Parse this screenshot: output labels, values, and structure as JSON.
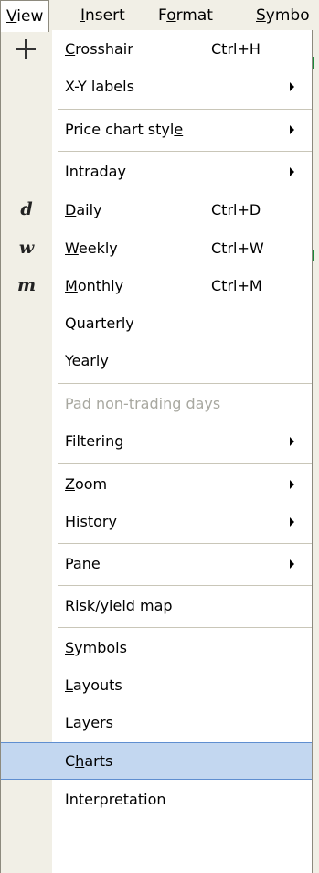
{
  "menubar": {
    "items": [
      {
        "label": "View",
        "mnemonic_index": 0
      },
      {
        "label": "Insert",
        "mnemonic_index": 0
      },
      {
        "label": "Format",
        "mnemonic_index": 1
      },
      {
        "label": "Symbo",
        "mnemonic_index": 0
      }
    ]
  },
  "menu": {
    "crosshair": {
      "label": "Crosshair",
      "shortcut": "Ctrl+H",
      "icon": "crosshair-icon"
    },
    "xy_labels": {
      "label": "X-Y labels"
    },
    "price_chart_style": {
      "label": "Price chart style"
    },
    "intraday": {
      "label": "Intraday"
    },
    "daily": {
      "label": "Daily",
      "shortcut": "Ctrl+D",
      "icon_glyph": "d"
    },
    "weekly": {
      "label": "Weekly",
      "shortcut": "Ctrl+W",
      "icon_glyph": "w"
    },
    "monthly": {
      "label": "Monthly",
      "shortcut": "Ctrl+M",
      "icon_glyph": "m"
    },
    "quarterly": {
      "label": "Quarterly"
    },
    "yearly": {
      "label": "Yearly"
    },
    "pad_non_trading": {
      "label": "Pad non-trading days",
      "disabled": true
    },
    "filtering": {
      "label": "Filtering"
    },
    "zoom": {
      "label": "Zoom"
    },
    "history": {
      "label": "History"
    },
    "pane": {
      "label": "Pane"
    },
    "risk_yield_map": {
      "label": "Risk/yield map"
    },
    "symbols": {
      "label": "Symbols"
    },
    "layouts": {
      "label": "Layouts"
    },
    "layers": {
      "label": "Layers"
    },
    "charts": {
      "label": "Charts",
      "highlighted": true
    },
    "interpretation": {
      "label": "Interpretation"
    }
  },
  "colors": {
    "menu_bg": "#ffffff",
    "gutter_bg": "#f1efe6",
    "highlight_bg": "#c3d7f0",
    "highlight_border": "#5f8ed0",
    "disabled_text": "#a8a8a0"
  }
}
